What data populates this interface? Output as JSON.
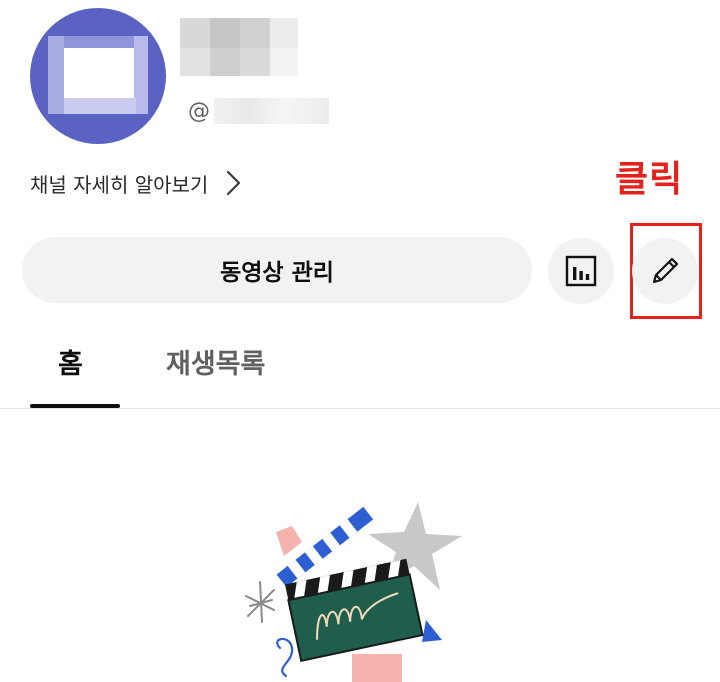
{
  "channel": {
    "handle_prefix": "@",
    "more_link_label": "채널 자세히 알아보기"
  },
  "annotation": {
    "label": "클릭",
    "color": "#e3221c"
  },
  "actions": {
    "manage_videos_label": "동영상 관리",
    "stats_icon": "bar-chart-icon",
    "edit_icon": "pencil-icon"
  },
  "tabs": [
    {
      "label": "홈",
      "selected": true
    },
    {
      "label": "재생목록",
      "selected": false
    }
  ],
  "colors": {
    "avatar_bg": "#5b63c2",
    "button_bg": "#f2f2f2",
    "annotation_red": "#e3221c"
  }
}
